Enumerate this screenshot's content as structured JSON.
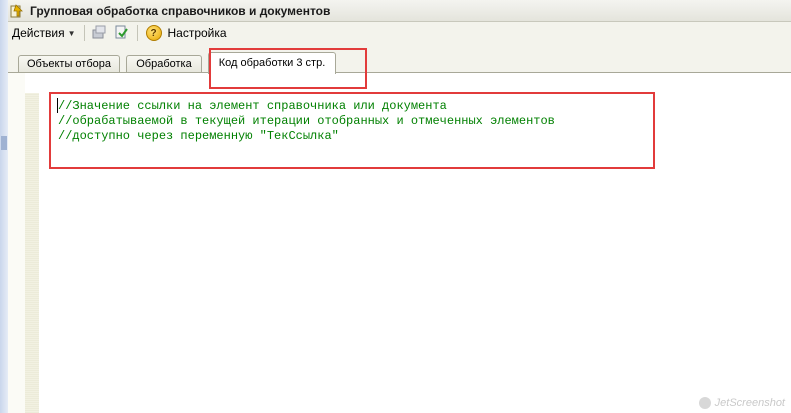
{
  "window": {
    "title": "Групповая обработка справочников и документов"
  },
  "toolbar": {
    "actions_label": "Действия",
    "settings_label": "Настройка"
  },
  "tabs": [
    {
      "label": "Объекты отбора",
      "active": false
    },
    {
      "label": "Обработка",
      "active": false
    },
    {
      "label": "Код обработки 3 стр.",
      "active": true
    }
  ],
  "editor": {
    "lines": [
      "//Значение ссылки на элемент справочника или документа",
      "//обрабатываемой в текущей итерации отобранных и отмеченных элементов",
      "//доступно через переменную \"ТекСсылка\""
    ]
  },
  "watermark": {
    "text": "JetScreenshot"
  },
  "colors": {
    "highlight": "#e23b3b",
    "comment_text": "#008000"
  }
}
